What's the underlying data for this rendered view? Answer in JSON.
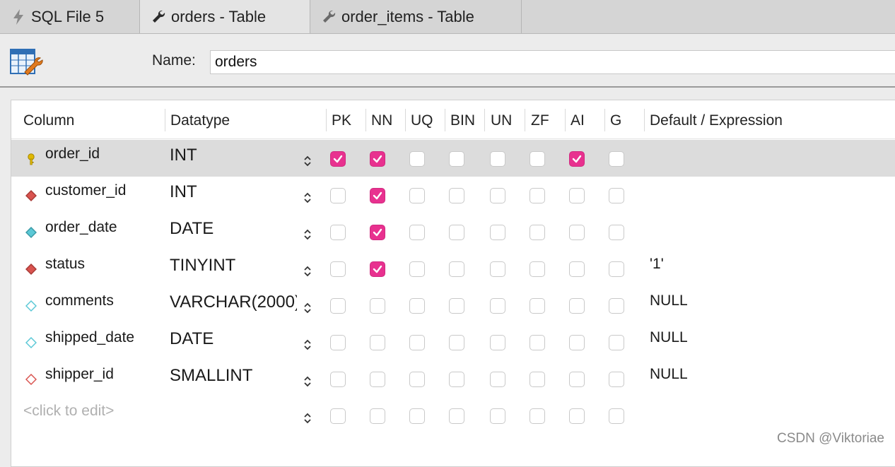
{
  "tabs": [
    {
      "label": "SQL File 5",
      "icon": "lightning-icon",
      "active": false
    },
    {
      "label": "orders - Table",
      "icon": "wrench-icon",
      "active": true
    },
    {
      "label": "order_items - Table",
      "icon": "wrench-icon",
      "active": false
    }
  ],
  "name_field": {
    "label": "Name:",
    "value": "orders"
  },
  "grid": {
    "headers": [
      "Column",
      "Datatype",
      "PK",
      "NN",
      "UQ",
      "BIN",
      "UN",
      "ZF",
      "AI",
      "G",
      "Default / Expression"
    ],
    "flag_keys": [
      "PK",
      "NN",
      "UQ",
      "BIN",
      "UN",
      "ZF",
      "AI",
      "G"
    ],
    "rows": [
      {
        "name": "order_id",
        "datatype": "INT",
        "icon": "primary-key-icon",
        "selected": true,
        "flags": {
          "PK": true,
          "NN": true,
          "UQ": false,
          "BIN": false,
          "UN": false,
          "ZF": false,
          "AI": true,
          "G": false
        },
        "default": ""
      },
      {
        "name": "customer_id",
        "datatype": "INT",
        "icon": "foreign-key-diamond-icon",
        "selected": false,
        "flags": {
          "PK": false,
          "NN": true,
          "UQ": false,
          "BIN": false,
          "UN": false,
          "ZF": false,
          "AI": false,
          "G": false
        },
        "default": ""
      },
      {
        "name": "order_date",
        "datatype": "DATE",
        "icon": "not-null-diamond-icon",
        "selected": false,
        "flags": {
          "PK": false,
          "NN": true,
          "UQ": false,
          "BIN": false,
          "UN": false,
          "ZF": false,
          "AI": false,
          "G": false
        },
        "default": ""
      },
      {
        "name": "status",
        "datatype": "TINYINT",
        "icon": "foreign-key-diamond-icon",
        "selected": false,
        "flags": {
          "PK": false,
          "NN": true,
          "UQ": false,
          "BIN": false,
          "UN": false,
          "ZF": false,
          "AI": false,
          "G": false
        },
        "default": "'1'"
      },
      {
        "name": "comments",
        "datatype": "VARCHAR(2000)",
        "icon": "nullable-diamond-icon",
        "selected": false,
        "flags": {
          "PK": false,
          "NN": false,
          "UQ": false,
          "BIN": false,
          "UN": false,
          "ZF": false,
          "AI": false,
          "G": false
        },
        "default": "NULL"
      },
      {
        "name": "shipped_date",
        "datatype": "DATE",
        "icon": "nullable-diamond-icon",
        "selected": false,
        "flags": {
          "PK": false,
          "NN": false,
          "UQ": false,
          "BIN": false,
          "UN": false,
          "ZF": false,
          "AI": false,
          "G": false
        },
        "default": "NULL"
      },
      {
        "name": "shipper_id",
        "datatype": "SMALLINT",
        "icon": "nullable-fk-diamond-icon",
        "selected": false,
        "flags": {
          "PK": false,
          "NN": false,
          "UQ": false,
          "BIN": false,
          "UN": false,
          "ZF": false,
          "AI": false,
          "G": false
        },
        "default": "NULL"
      }
    ],
    "placeholder_row": {
      "name": "<click to edit>"
    }
  },
  "watermark": "CSDN @Viktoriae",
  "colors": {
    "check_on": "#e8318f",
    "selected_row": "#dcdcdc",
    "key": "#e0b800",
    "fk_diamond": "#d9534f",
    "nn_diamond": "#5bc8d6"
  }
}
